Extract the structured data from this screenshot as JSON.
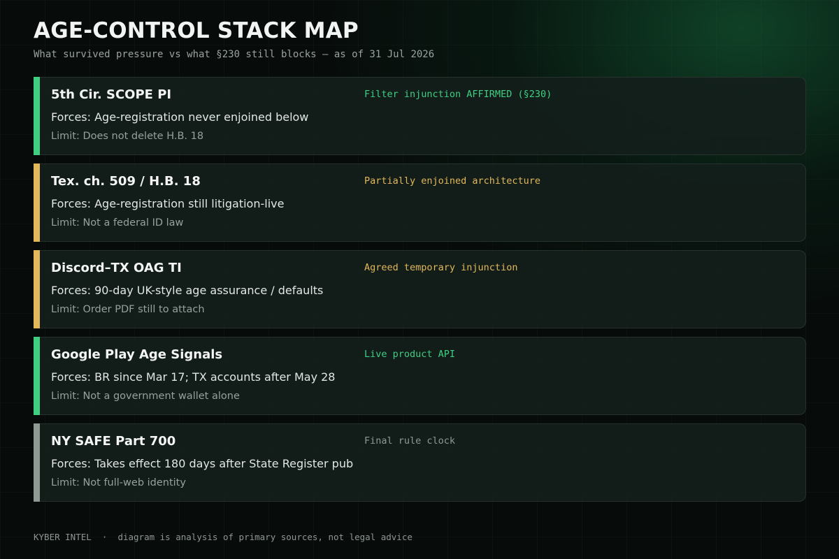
{
  "header": {
    "title": "AGE-CONTROL STACK MAP",
    "subtitle": "What survived pressure vs what §230 still blocks — as of 31 Jul 2026"
  },
  "colors": {
    "green": "#3fcf82",
    "amber": "#e2b85a",
    "gray": "#8f9a95"
  },
  "cards": [
    {
      "name": "5th Cir. SCOPE PI",
      "status": "Filter injunction AFFIRMED (§230)",
      "forces": "Forces: Age-registration never enjoined below",
      "limit": "Limit: Does not delete H.B. 18",
      "accent": "#3fcf82"
    },
    {
      "name": "Tex. ch. 509 / H.B. 18",
      "status": "Partially enjoined architecture",
      "forces": "Forces: Age-registration still litigation-live",
      "limit": "Limit: Not a federal ID law",
      "accent": "#e2b85a"
    },
    {
      "name": "Discord–TX OAG TI",
      "status": "Agreed temporary injunction",
      "forces": "Forces: 90-day UK-style age assurance / defaults",
      "limit": "Limit: Order PDF still to attach",
      "accent": "#e2b85a"
    },
    {
      "name": "Google Play Age Signals",
      "status": "Live product API",
      "forces": "Forces: BR since Mar 17; TX accounts after May 28",
      "limit": "Limit: Not a government wallet alone",
      "accent": "#3fcf82"
    },
    {
      "name": "NY SAFE Part 700",
      "status": "Final rule clock",
      "forces": "Forces: Takes effect 180 days after State Register pub",
      "limit": "Limit: Not full-web identity",
      "accent": "#8f9a95"
    }
  ],
  "footer": {
    "brand": "KYBER INTEL",
    "separator": "·",
    "note": "diagram is analysis of primary sources, not legal advice"
  }
}
